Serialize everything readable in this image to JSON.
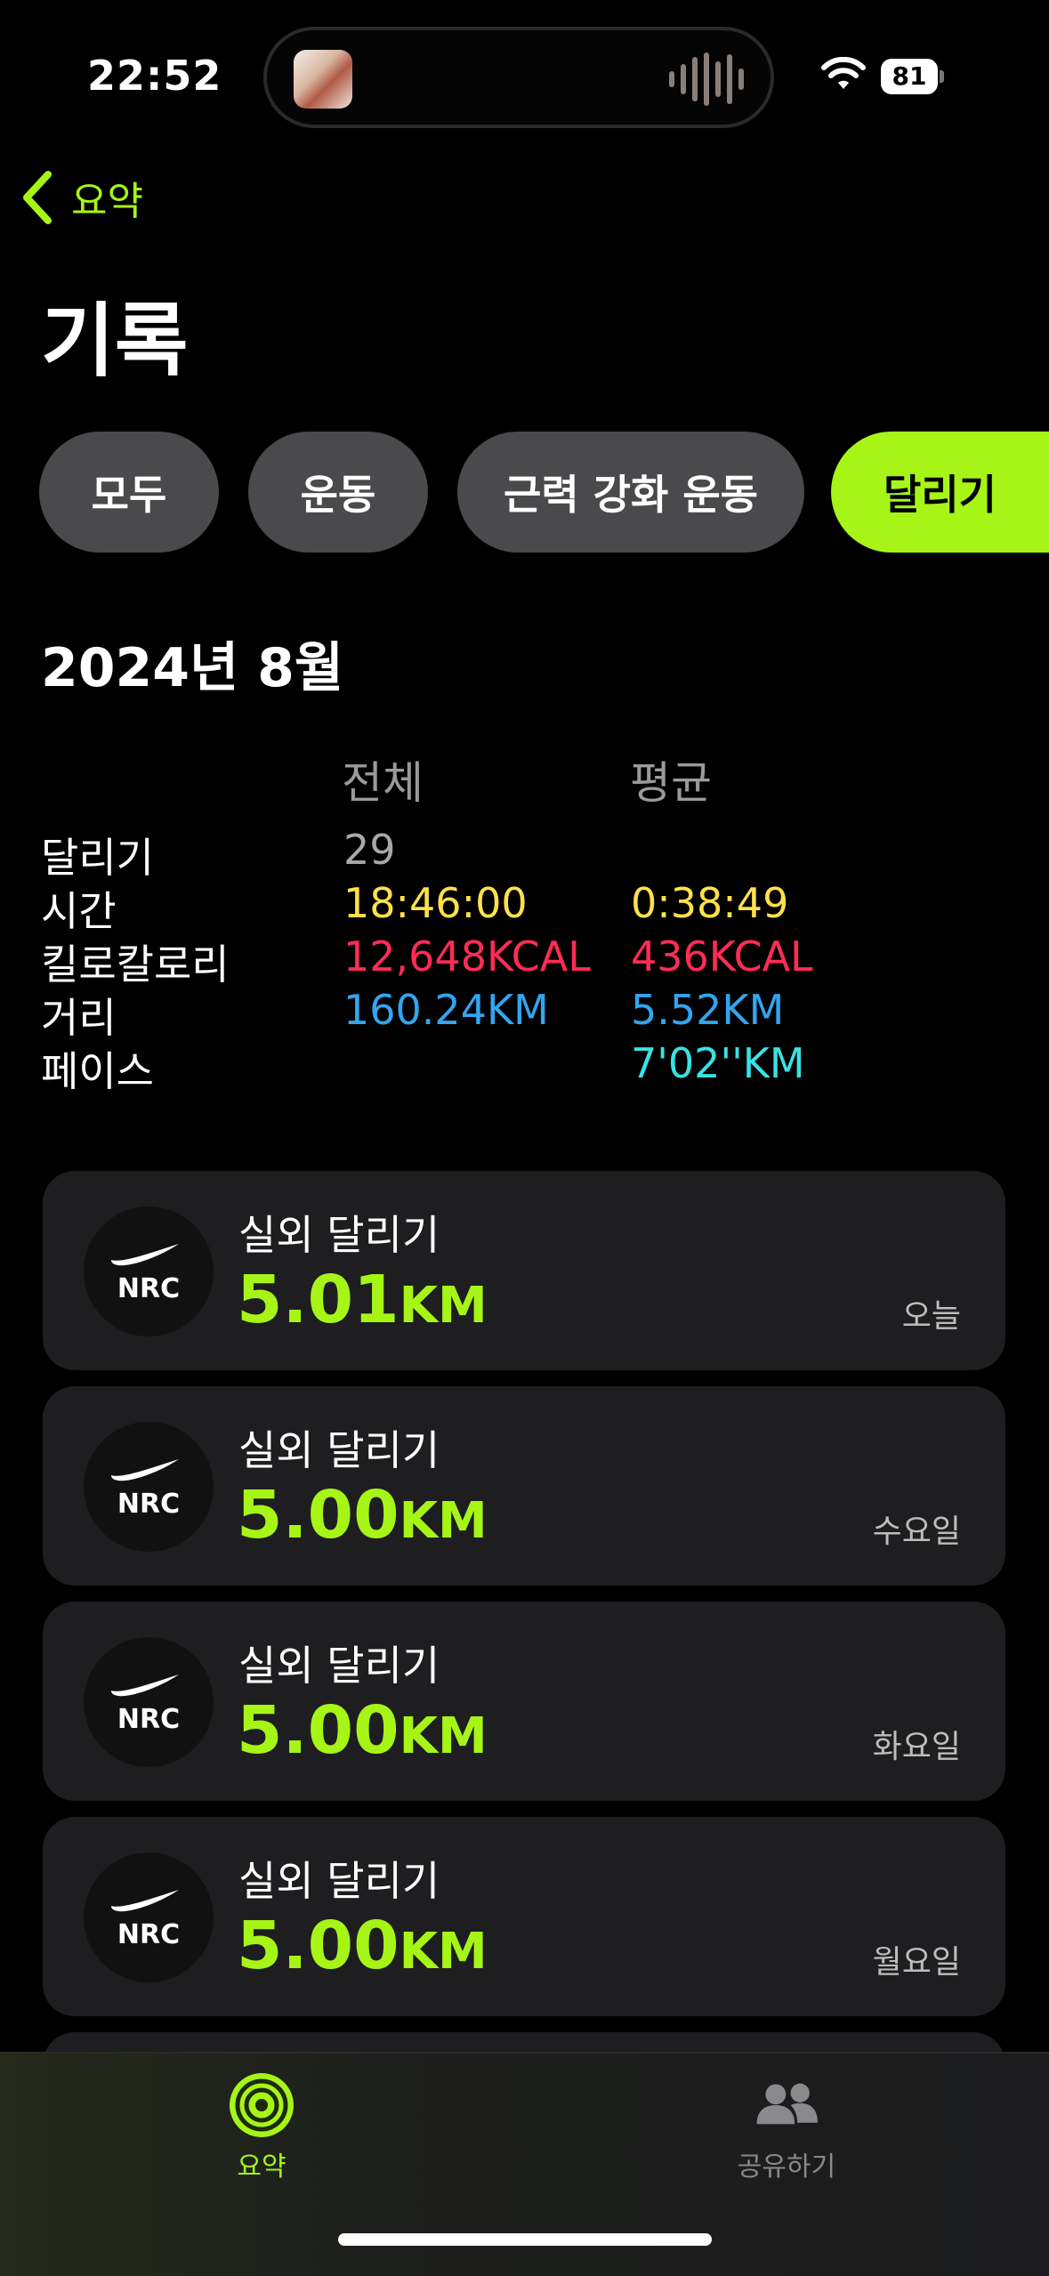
{
  "status_bar": {
    "time": "22:52",
    "battery": "81"
  },
  "nav": {
    "back_label": "요약",
    "title": "기록"
  },
  "filters": [
    {
      "label": "모두",
      "active": false
    },
    {
      "label": "운동",
      "active": false
    },
    {
      "label": "근력 강화 운동",
      "active": false
    },
    {
      "label": "달리기",
      "active": true
    }
  ],
  "summary": {
    "month": "2024년 8월",
    "col_total": "전체",
    "col_average": "평균",
    "rows": [
      {
        "label": "달리기",
        "total": "29",
        "average": ""
      },
      {
        "label": "시간",
        "total": "18:46:00",
        "average": "0:38:49"
      },
      {
        "label": "킬로칼로리",
        "total": "12,648KCAL",
        "average": "436KCAL"
      },
      {
        "label": "거리",
        "total": "160.24KM",
        "average": "5.52KM"
      },
      {
        "label": "페이스",
        "total": "",
        "average": "7'02''KM"
      }
    ]
  },
  "workouts": [
    {
      "type": "실외 달리기",
      "distance": "5.01",
      "unit": "KM",
      "day": "오늘",
      "icon": "nrc-icon"
    },
    {
      "type": "실외 달리기",
      "distance": "5.00",
      "unit": "KM",
      "day": "수요일",
      "icon": "nrc-icon"
    },
    {
      "type": "실외 달리기",
      "distance": "5.00",
      "unit": "KM",
      "day": "화요일",
      "icon": "nrc-icon"
    },
    {
      "type": "실외 달리기",
      "distance": "5.00",
      "unit": "KM",
      "day": "월요일",
      "icon": "nrc-icon"
    }
  ],
  "nrc_text": "NRC",
  "tabbar": {
    "summary_label": "요약",
    "sharing_label": "공유하기"
  },
  "colors": {
    "accent": "#a6f517",
    "time": "#ffe14a",
    "calories": "#ff2c55",
    "distance": "#32a5ef",
    "pace": "#38e3e3"
  }
}
